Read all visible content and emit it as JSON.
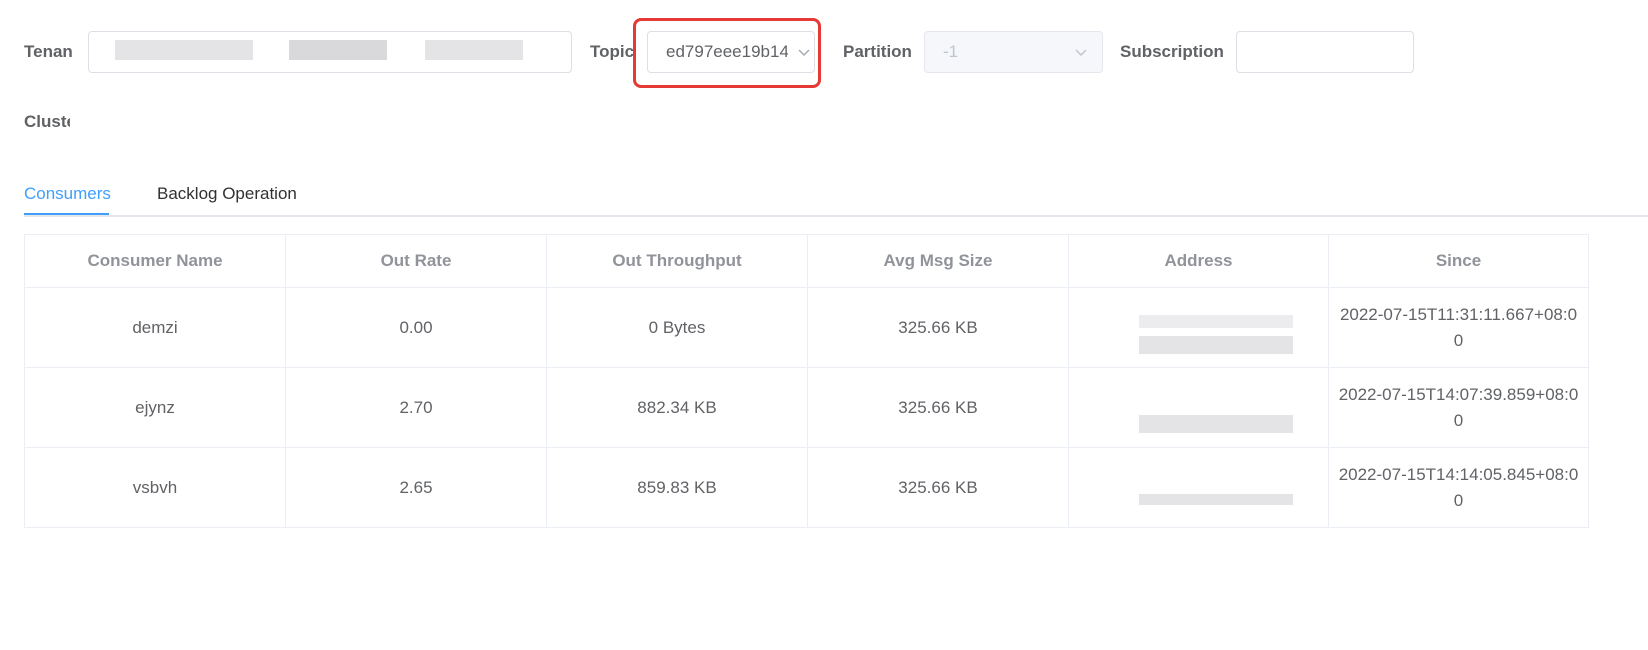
{
  "filters": {
    "tenant_label": "Tenan",
    "topic_label": "Topic",
    "topic_value": "ed797eee19b14",
    "partition_label": "Partition",
    "partition_value": "-1",
    "subscription_label": "Subscription",
    "subscription_value": "",
    "cluster_label": "Clustе"
  },
  "tabs": [
    {
      "label": "Consumers",
      "active": true
    },
    {
      "label": "Backlog Operation",
      "active": false
    }
  ],
  "table": {
    "columns": [
      "Consumer Name",
      "Out Rate",
      "Out Throughput",
      "Avg Msg Size",
      "Address",
      "Since"
    ],
    "rows": [
      {
        "name": "demzi",
        "out_rate": "0.00",
        "out_throughput": "0 Bytes",
        "avg_msg_size": "325.66 KB",
        "address": "",
        "since_line1": "2022-07-15T11:31:11.667+08:0",
        "since_line2": "0"
      },
      {
        "name": "ejynz",
        "out_rate": "2.70",
        "out_throughput": "882.34 KB",
        "avg_msg_size": "325.66 KB",
        "address": "",
        "since_line1": "2022-07-15T14:07:39.859+08:0",
        "since_line2": "0"
      },
      {
        "name": "vsbvh",
        "out_rate": "2.65",
        "out_throughput": "859.83 KB",
        "avg_msg_size": "325.66 KB",
        "address": "",
        "since_line1": "2022-07-15T14:14:05.845+08:0",
        "since_line2": "0"
      }
    ]
  },
  "colors": {
    "accent": "#409eff",
    "highlight": "#e53935",
    "border": "#dcdfe6"
  },
  "icons": {
    "dropdown": "chevron-down-icon"
  }
}
